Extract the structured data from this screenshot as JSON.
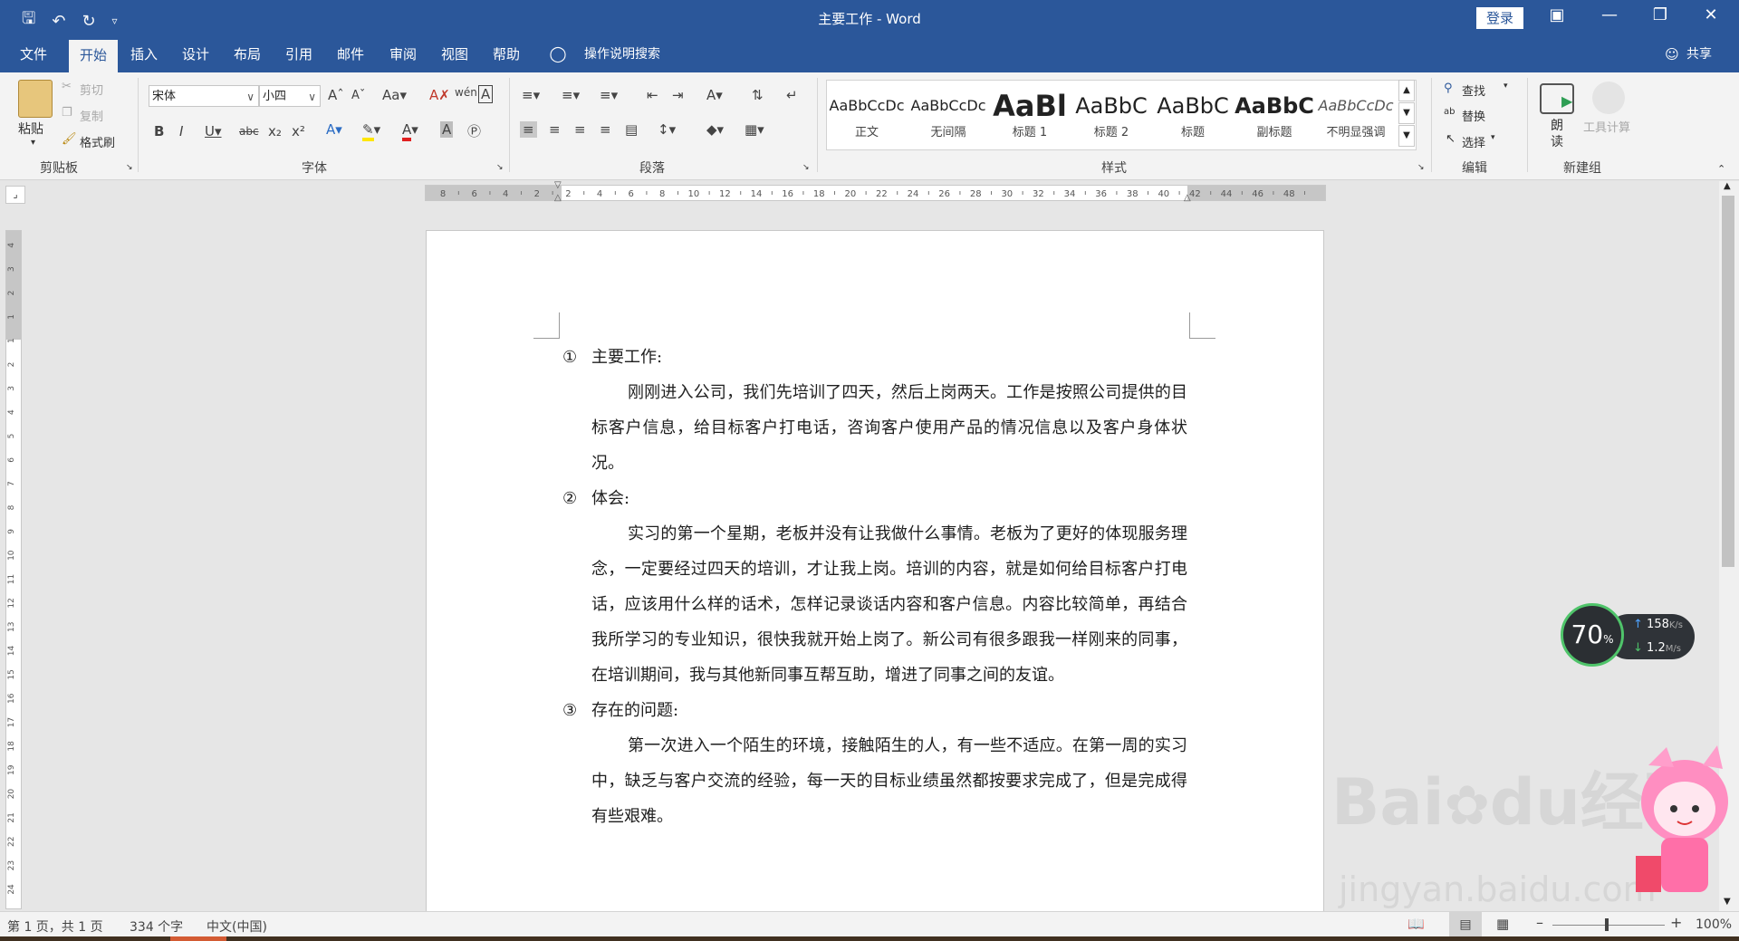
{
  "titlebar": {
    "title": "主要工作 - Word",
    "login": "登录",
    "share": "共享"
  },
  "tabs": [
    "文件",
    "开始",
    "插入",
    "设计",
    "布局",
    "引用",
    "邮件",
    "审阅",
    "视图",
    "帮助"
  ],
  "tell_me": "操作说明搜索",
  "clipboard": {
    "paste": "粘贴",
    "cut": "剪切",
    "copy": "复制",
    "format_painter": "格式刷",
    "label": "剪贴板"
  },
  "font": {
    "name": "宋体",
    "size": "小四",
    "label": "字体"
  },
  "paragraph": {
    "label": "段落"
  },
  "styles": {
    "label": "样式",
    "items": [
      {
        "sample": "AaBbCcDc",
        "name": "正文"
      },
      {
        "sample": "AaBbCcDc",
        "name": "无间隔"
      },
      {
        "sample": "AaBl",
        "name": "标题 1"
      },
      {
        "sample": "AaBbC",
        "name": "标题 2"
      },
      {
        "sample": "AaBbC",
        "name": "标题"
      },
      {
        "sample": "AaBbC",
        "name": "副标题"
      },
      {
        "sample": "AaBbCcDc",
        "name": "不明显强调"
      }
    ]
  },
  "editing": {
    "find": "查找",
    "replace": "替换",
    "select": "选择",
    "label": "编辑"
  },
  "newgroup": {
    "read": "朗读",
    "tool": "工具计算",
    "label": "新建组"
  },
  "ruler": {
    "horizontal": [
      "8",
      "6",
      "4",
      "2",
      "2",
      "4",
      "6",
      "8",
      "10",
      "12",
      "14",
      "16",
      "18",
      "20",
      "22",
      "24",
      "26",
      "28",
      "30",
      "32",
      "34",
      "36",
      "38",
      "40",
      "42",
      "44",
      "46",
      "48"
    ],
    "vertical": [
      "4",
      "3",
      "2",
      "1",
      "1",
      "2",
      "3",
      "4",
      "5",
      "6",
      "7",
      "8",
      "9",
      "10",
      "11",
      "12",
      "13",
      "14",
      "15",
      "16",
      "17",
      "18",
      "19",
      "20",
      "21",
      "22",
      "23",
      "24"
    ]
  },
  "document": {
    "sections": [
      {
        "num": "①",
        "heading": "主要工作:",
        "body": "刚刚进入公司，我们先培训了四天，然后上岗两天。工作是按照公司提供的目标客户信息，给目标客户打电话，咨询客户使用产品的情况信息以及客户身体状况。"
      },
      {
        "num": "②",
        "heading": "体会:",
        "body": "实习的第一个星期，老板并没有让我做什么事情。老板为了更好的体现服务理念，一定要经过四天的培训，才让我上岗。培训的内容，就是如何给目标客户打电话，应该用什么样的话术，怎样记录谈话内容和客户信息。内容比较简单，再结合我所学习的专业知识，很快我就开始上岗了。新公司有很多跟我一样刚来的同事，在培训期间，我与其他新同事互帮互助，增进了同事之间的友谊。"
      },
      {
        "num": "③",
        "heading": "存在的问题:",
        "body": "第一次进入一个陌生的环境，接触陌生的人，有一些不适应。在第一周的实习中，缺乏与客户交流的经验，每一天的目标业绩虽然都按要求完成了，但是完成得有些艰难。"
      }
    ]
  },
  "status": {
    "page": "第 1 页，共 1 页",
    "words": "334 个字",
    "lang": "中文(中国)",
    "zoom": "100%"
  },
  "widget": {
    "percent": "70",
    "percent_unit": "%",
    "up": "158",
    "up_unit": "K/s",
    "down": "1.2",
    "down_unit": "M/s"
  },
  "watermark": {
    "line1": "Bai",
    "line1b": "du",
    "line1c": "经验",
    "line2": "jingyan.baidu.com"
  },
  "colors": {
    "accent": "#2b579a",
    "ribbon_bg": "#f3f3f3"
  }
}
